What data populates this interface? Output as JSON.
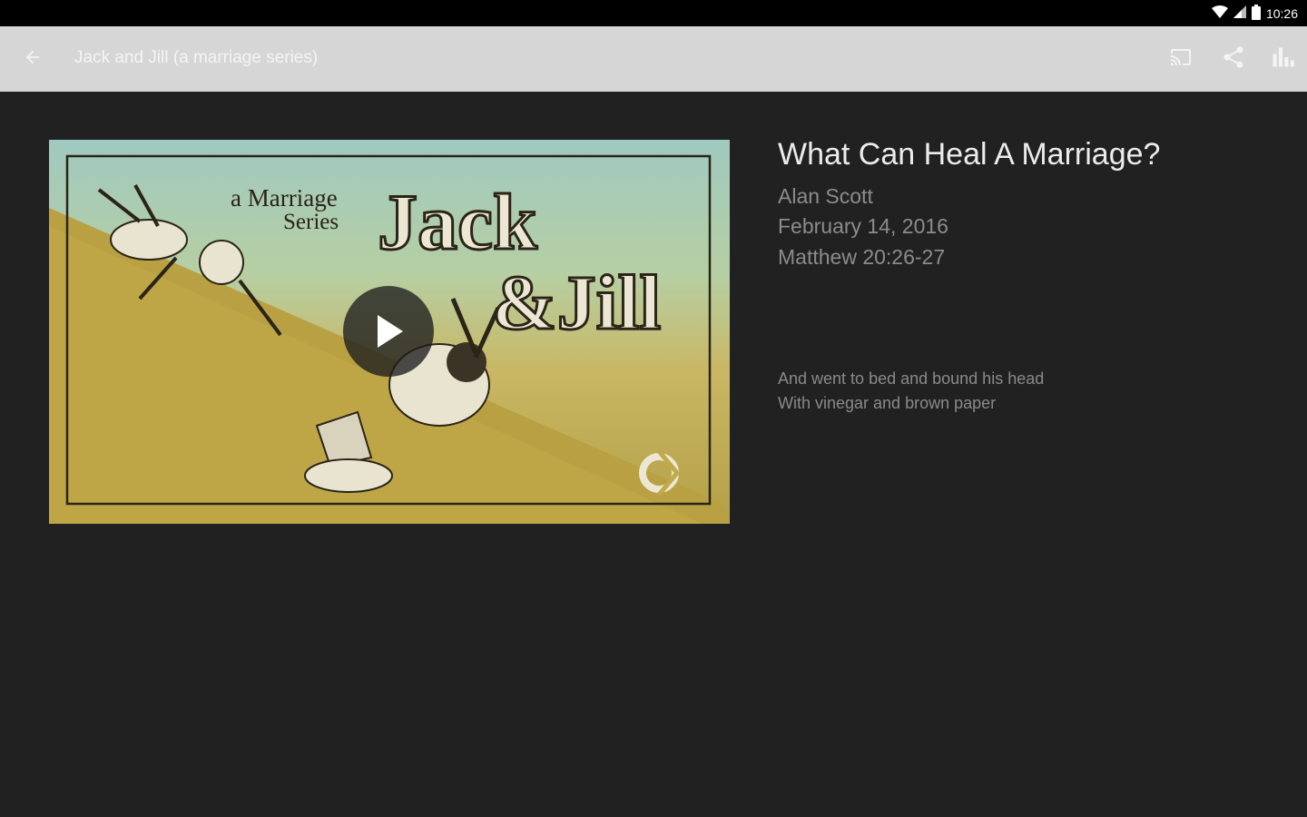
{
  "status_bar": {
    "time": "10:26",
    "icons": [
      "wifi-icon",
      "signal-icon",
      "battery-icon"
    ]
  },
  "app_bar": {
    "title": "Jack and Jill (a marriage series)",
    "actions": [
      "cast-icon",
      "share-icon",
      "bar-chart-icon"
    ]
  },
  "artwork": {
    "line1": "a Marriage",
    "line2": "Series",
    "line3": "Jack",
    "line4": "&Jill"
  },
  "sermon": {
    "title": "What Can Heal A Marriage?",
    "speaker": "Alan Scott",
    "date": "February 14, 2016",
    "scripture": "Matthew 20:26-27",
    "description_line1": "And went to bed and bound his head",
    "description_line2": "With vinegar and brown paper"
  },
  "colors": {
    "background": "#212121",
    "app_bar": "#d6d6d6",
    "title_text": "#ececec",
    "meta_text": "#8c8c8c"
  }
}
